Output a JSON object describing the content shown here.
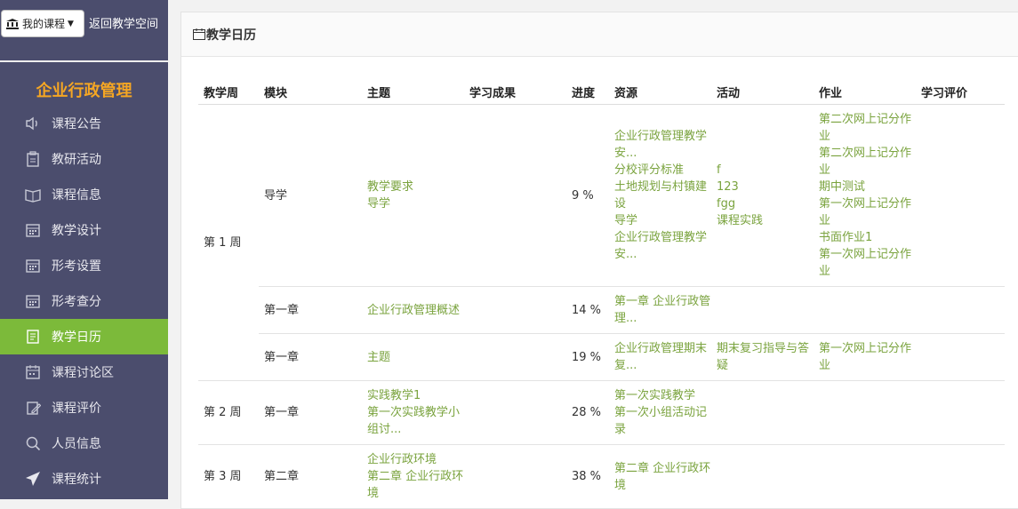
{
  "header": {
    "my_courses": "我的课程",
    "back_label": "返回教学空间"
  },
  "sidebar": {
    "course_title": "企业行政管理",
    "items": [
      {
        "label": "课程公告",
        "icon": "speaker-icon"
      },
      {
        "label": "教研活动",
        "icon": "clipboard-icon"
      },
      {
        "label": "课程信息",
        "icon": "book-icon"
      },
      {
        "label": "教学设计",
        "icon": "calendar-icon"
      },
      {
        "label": "形考设置",
        "icon": "calendar-icon"
      },
      {
        "label": "形考查分",
        "icon": "calendar-icon"
      },
      {
        "label": "教学日历",
        "icon": "list-icon"
      },
      {
        "label": "课程讨论区",
        "icon": "calendar-grid-icon"
      },
      {
        "label": "课程评价",
        "icon": "edit-icon"
      },
      {
        "label": "人员信息",
        "icon": "search-icon"
      },
      {
        "label": "课程统计",
        "icon": "send-icon"
      }
    ]
  },
  "panel": {
    "title": "教学日历"
  },
  "table": {
    "headers": [
      "教学周",
      "模块",
      "主题",
      "学习成果",
      "进度",
      "资源",
      "活动",
      "作业",
      "学习评价"
    ],
    "weeks": [
      {
        "week": "第 1 周",
        "rows": [
          {
            "module": "导学",
            "topics": [
              "教学要求",
              "导学"
            ],
            "outcome": "",
            "progress": "9 %",
            "resources": [
              "企业行政管理教学安...",
              "分校评分标准",
              "土地规划与村镇建设",
              "导学",
              "企业行政管理教学安..."
            ],
            "activities": [
              "f",
              "123",
              "fgg",
              "课程实践"
            ],
            "homework": [
              "第二次网上记分作业",
              "第二次网上记分作业",
              "期中测试",
              "第一次网上记分作业",
              "书面作业1",
              "第一次网上记分作业"
            ],
            "evaluation": ""
          },
          {
            "module": "第一章",
            "topics": [
              "企业行政管理概述"
            ],
            "outcome": "",
            "progress": "14 %",
            "resources": [
              "第一章 企业行政管理..."
            ],
            "activities": [],
            "homework": [],
            "evaluation": ""
          },
          {
            "module": "第一章",
            "topics": [
              "主题"
            ],
            "outcome": "",
            "progress": "19 %",
            "resources": [
              "企业行政管理期末复..."
            ],
            "activities": [
              "期末复习指导与答疑"
            ],
            "homework": [
              "第一次网上记分作业"
            ],
            "evaluation": ""
          }
        ]
      },
      {
        "week": "第 2 周",
        "rows": [
          {
            "module": "第一章",
            "topics": [
              "实践教学1",
              "第一次实践教学小组讨..."
            ],
            "outcome": "",
            "progress": "28 %",
            "resources": [
              "第一次实践教学",
              "第一次小组活动记录"
            ],
            "activities": [],
            "homework": [],
            "evaluation": ""
          }
        ]
      },
      {
        "week": "第 3 周",
        "rows": [
          {
            "module": "第二章",
            "topics": [
              "企业行政环境",
              "第二章 企业行政环境"
            ],
            "outcome": "",
            "progress": "38 %",
            "resources": [
              "第二章 企业行政环境"
            ],
            "activities": [],
            "homework": [],
            "evaluation": ""
          }
        ]
      }
    ]
  },
  "colors": {
    "sidebar_bg": "#4b4d6d",
    "active_bg": "#7cba3a",
    "link": "#7aa33e",
    "course_title": "#f5a623"
  }
}
